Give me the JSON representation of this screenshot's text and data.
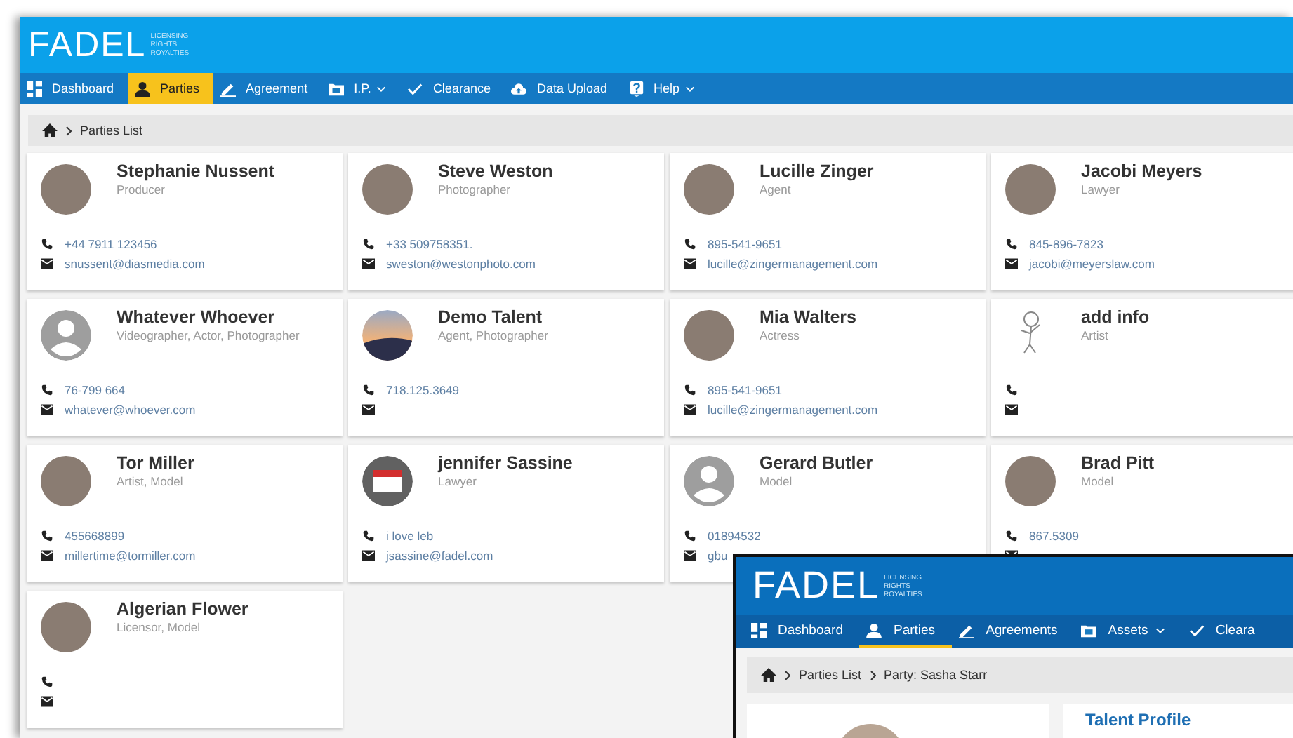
{
  "header": {
    "logo": "FADEL",
    "tagline": [
      "LICENSING",
      "RIGHTS",
      "ROYALTIES"
    ]
  },
  "nav": [
    {
      "label": "Dashboard",
      "kind": "grid",
      "selected": false,
      "dropdown": false
    },
    {
      "label": "Parties",
      "kind": "person",
      "selected": true,
      "dropdown": false
    },
    {
      "label": "Agreement",
      "kind": "pen",
      "selected": false,
      "dropdown": false
    },
    {
      "label": "I.P.",
      "kind": "folder",
      "selected": false,
      "dropdown": true
    },
    {
      "label": "Clearance",
      "kind": "check",
      "selected": false,
      "dropdown": false
    },
    {
      "label": "Data Upload",
      "kind": "cloud",
      "selected": false,
      "dropdown": false
    },
    {
      "label": "Help",
      "kind": "help",
      "selected": false,
      "dropdown": true
    }
  ],
  "breadcrumb": [
    "Parties List"
  ],
  "parties": [
    {
      "name": "Stephanie Nussent",
      "roles": "Producer",
      "kind": "photo",
      "phone": "+44 7911 123456",
      "email": "snussent@diasmedia.com"
    },
    {
      "name": "Steve Weston",
      "roles": "Photographer",
      "kind": "photo",
      "phone": "+33 509758351.",
      "email": "sweston@westonphoto.com"
    },
    {
      "name": "Lucille Zinger",
      "roles": "Agent",
      "kind": "photo",
      "phone": "895-541-9651",
      "email": "lucille@zingermanagement.com"
    },
    {
      "name": "Jacobi Meyers",
      "roles": "Lawyer",
      "kind": "photo",
      "phone": "845-896-7823",
      "email": "jacobi@meyerslaw.com"
    },
    {
      "name": "Whatever Whoever",
      "roles": "Videographer, Actor, Photographer",
      "kind": "generic",
      "phone": "76-799 664",
      "email": "whatever@whoever.com"
    },
    {
      "name": "Demo Talent",
      "roles": "Agent, Photographer",
      "kind": "landscape",
      "phone": "718.125.3649"
    },
    {
      "name": "Mia Walters",
      "roles": "Actress",
      "kind": "photo",
      "phone": "895-541-9651",
      "email": "lucille@zingermanagement.com"
    },
    {
      "name": "add info",
      "roles": "Artist",
      "kind": "sketch"
    },
    {
      "name": "Tor Miller",
      "roles": "Artist, Model",
      "kind": "photo",
      "phone": "455668899",
      "email": "millertime@tormiller.com"
    },
    {
      "name": "jennifer Sassine",
      "roles": "Lawyer",
      "kind": "calendar",
      "phone": "i love leb",
      "email": "jsassine@fadel.com"
    },
    {
      "name": "Gerard Butler",
      "roles": "Model",
      "kind": "generic",
      "phone": "01894532",
      "email": "gbu"
    },
    {
      "name": "Brad Pitt",
      "roles": "Model",
      "kind": "photo",
      "phone": "867.5309"
    },
    {
      "name": "Algerian Flower",
      "roles": "Licensor, Model",
      "kind": "photo"
    }
  ],
  "inset_window": {
    "header": {
      "logo": "FADEL",
      "tagline": [
        "LICENSING",
        "RIGHTS",
        "ROYALTIES"
      ]
    },
    "nav": [
      {
        "label": "Dashboard",
        "kind": "grid",
        "selected": false,
        "dropdown": false
      },
      {
        "label": "Parties",
        "kind": "person",
        "selected": true,
        "dropdown": false
      },
      {
        "label": "Agreements",
        "kind": "pen",
        "selected": false,
        "dropdown": false
      },
      {
        "label": "Assets",
        "kind": "folder",
        "selected": false,
        "dropdown": true
      },
      {
        "label": "Cleara",
        "kind": "check",
        "selected": false,
        "dropdown": false
      }
    ],
    "breadcrumb": [
      "Parties List",
      "Party: Sasha Starr"
    ],
    "profile_heading": "Talent Profile"
  }
}
